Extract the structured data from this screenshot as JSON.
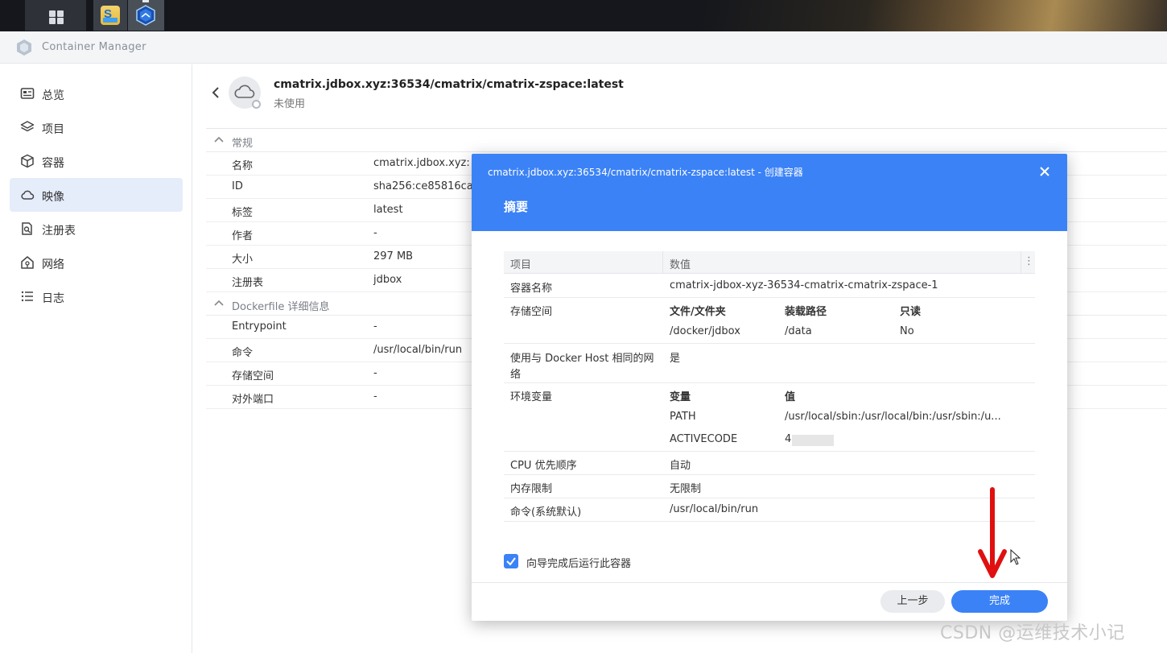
{
  "app": {
    "title": "Container Manager"
  },
  "sidebar": {
    "items": [
      {
        "label": "总览",
        "icon": "dashboard-icon",
        "active": false
      },
      {
        "label": "项目",
        "icon": "layers-icon",
        "active": false
      },
      {
        "label": "容器",
        "icon": "cube-icon",
        "active": false
      },
      {
        "label": "映像",
        "icon": "cloud-icon",
        "active": true
      },
      {
        "label": "注册表",
        "icon": "registry-search-icon",
        "active": false
      },
      {
        "label": "网络",
        "icon": "network-icon",
        "active": false
      },
      {
        "label": "日志",
        "icon": "list-icon",
        "active": false
      }
    ]
  },
  "image": {
    "title": "cmatrix.jdbox.xyz:36534/cmatrix/cmatrix-zspace:latest",
    "status": "未使用"
  },
  "details": {
    "general_title": "常规",
    "general": [
      {
        "key": "名称",
        "value": "cmatrix.jdbox.xyz:"
      },
      {
        "key": "ID",
        "value": "sha256:ce85816ca"
      },
      {
        "key": "标签",
        "value": "latest"
      },
      {
        "key": "作者",
        "value": "-"
      },
      {
        "key": "大小",
        "value": "297 MB"
      },
      {
        "key": "注册表",
        "value": "jdbox"
      }
    ],
    "dockerfile_title": "Dockerfile 详细信息",
    "dockerfile": [
      {
        "key": "Entrypoint",
        "value": "-"
      },
      {
        "key": "命令",
        "value": "/usr/local/bin/run"
      },
      {
        "key": "存储空间",
        "value": "-"
      },
      {
        "key": "对外端口",
        "value": "-"
      }
    ]
  },
  "modal": {
    "title": "cmatrix.jdbox.xyz:36534/cmatrix/cmatrix-zspace:latest - 创建容器",
    "subtitle": "摘要",
    "col_item": "项目",
    "col_value": "数值",
    "more": "⋮",
    "container_name_key": "容器名称",
    "container_name_value": "cmatrix-jdbox-xyz-36534-cmatrix-cmatrix-zspace-1",
    "storage_key": "存储空间",
    "storage_headers": [
      "文件/文件夹",
      "装载路径",
      "只读"
    ],
    "storage_row": [
      "/docker/jdbox",
      "/data",
      "No"
    ],
    "host_net_key_line1": "使用与 Docker Host 相同的网",
    "host_net_key_line2": "络",
    "host_net_value": "是",
    "env_key": "环境变量",
    "env_headers": [
      "变量",
      "值"
    ],
    "env_rows": [
      [
        "PATH",
        "/usr/local/sbin:/usr/local/bin:/usr/sbin:/u..."
      ],
      [
        "ACTIVECODE",
        "4"
      ]
    ],
    "cpu_key": "CPU 优先顺序",
    "cpu_value": "自动",
    "mem_key": "内存限制",
    "mem_value": "无限制",
    "cmd_key": "命令(系统默认)",
    "cmd_value": "/usr/local/bin/run",
    "run_after_label": "向导完成后运行此容器",
    "run_after_checked": true,
    "prev_button": "上一步",
    "done_button": "完成"
  },
  "watermark": "CSDN @运维技术小记",
  "colors": {
    "accent": "#3b82f6",
    "arrow": "#e01010",
    "active_nav": "#e5ecfa"
  }
}
